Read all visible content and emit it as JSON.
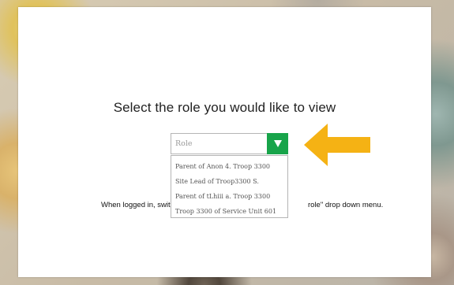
{
  "dialog": {
    "title": "Select the role you would like to view",
    "help_text_left": "When logged in, switch b",
    "help_text_right": "role\" drop down menu."
  },
  "role_select": {
    "placeholder": "Role",
    "options": [
      "Parent of Anon 4. Troop 3300",
      "Site Lead of Troop3300 S.",
      "Parent of tLhiii a. Troop 3300",
      "Troop 3300 of Service Unit 601"
    ],
    "button_icon": "triangle-down-icon"
  },
  "pointer_arrow_icon": "left-arrow-icon",
  "colors": {
    "accent_green": "#18a44a",
    "arrow_orange": "#f5b214"
  }
}
